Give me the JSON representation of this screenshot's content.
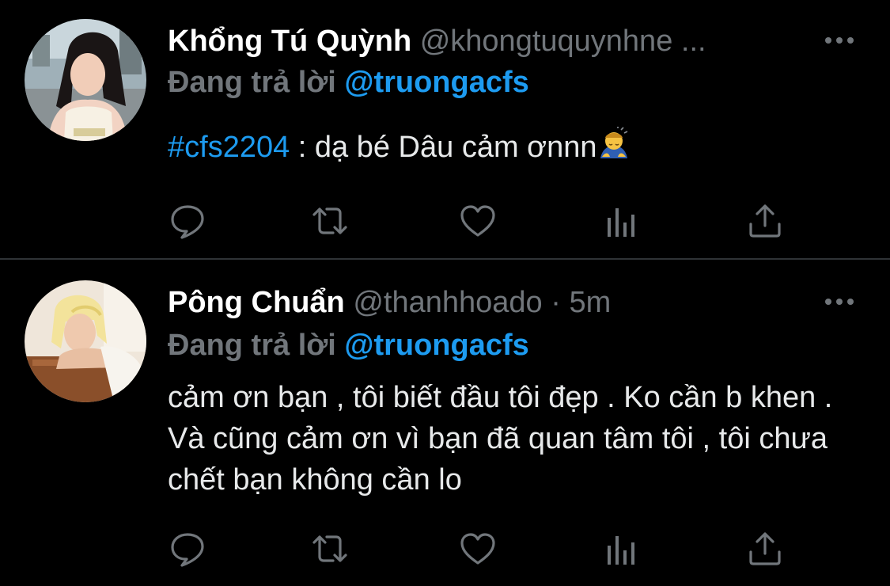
{
  "colors": {
    "background": "#000000",
    "accent": "#1d9bf0",
    "secondary_text": "#71767b",
    "divider": "#2f3336"
  },
  "tweets": [
    {
      "display_name": "Khổng Tú Quỳnh",
      "handle": "@khongtuquynhne ...",
      "time": "",
      "reply_prefix": "Đang trả lời",
      "reply_to": "@truongacfs",
      "hashtag": "#cfs2204",
      "text": " : dạ bé Dâu cảm ơnnn",
      "emoji": "person-bowing-emoji",
      "more_icon": "more-horizontal-icon"
    },
    {
      "display_name": "Pông Chuẩn",
      "handle": "@thanhhoado",
      "dot": "·",
      "time": "5m",
      "reply_prefix": "Đang trả lời",
      "reply_to": "@truongacfs",
      "text": "cảm ơn bạn , tôi biết đầu tôi đẹp . Ko cần b khen . Và cũng cảm ơn vì bạn đã quan tâm tôi , tôi chưa chết bạn không cần lo",
      "more_icon": "more-horizontal-icon"
    }
  ],
  "action_icons": [
    "reply-icon",
    "retweet-icon",
    "like-icon",
    "analytics-icon",
    "share-icon"
  ]
}
